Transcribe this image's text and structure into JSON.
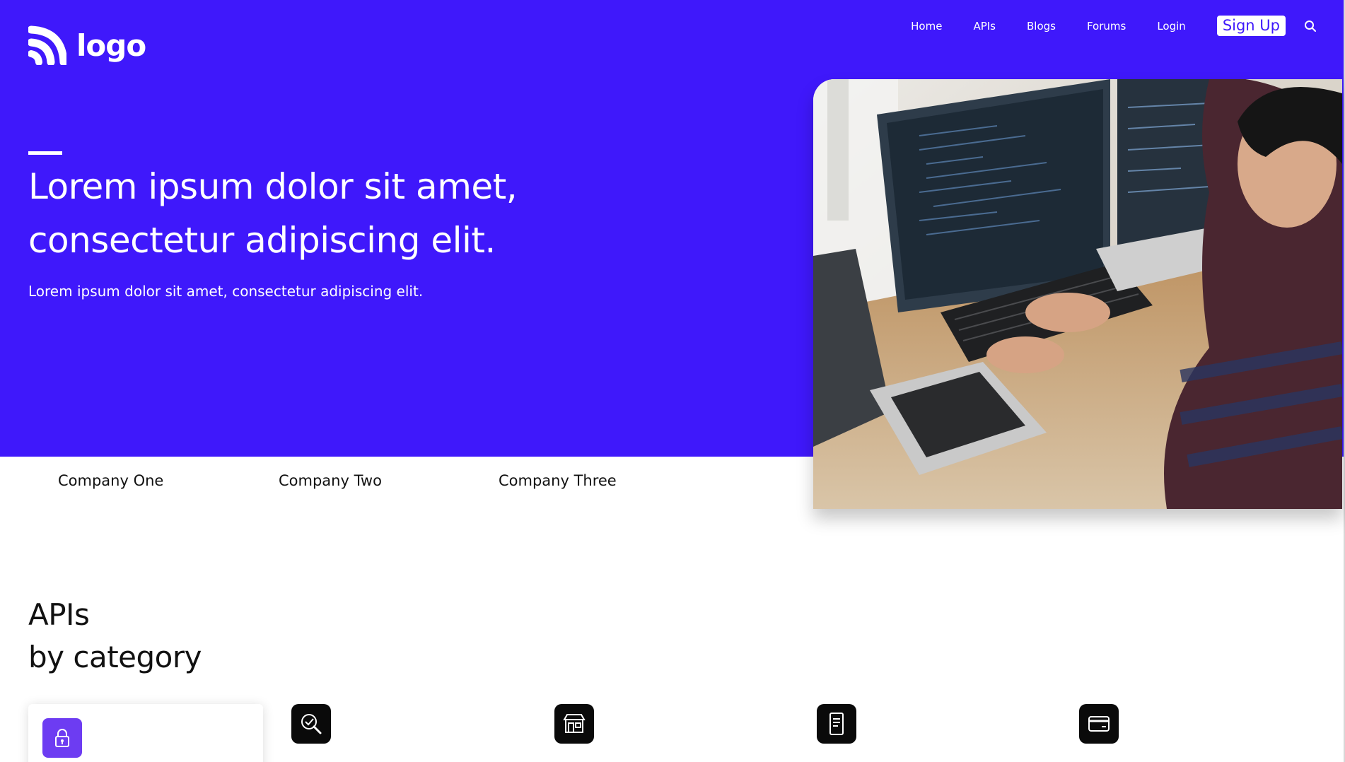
{
  "header": {
    "logo_text": "logo",
    "nav": [
      "Home",
      "APIs",
      "Blogs",
      "Forums",
      "Login"
    ],
    "signup_label": "Sign Up"
  },
  "hero": {
    "title": "Lorem ipsum dolor sit amet, consectetur adipiscing elit.",
    "subtitle": "Lorem ipsum dolor sit amet, consectetur adipiscing elit."
  },
  "companies": [
    "Company One",
    "Company Two",
    "Company Three"
  ],
  "section": {
    "title_line1": "APIs",
    "title_line2": "by category"
  },
  "icons": {
    "search": "search-icon",
    "card": "lock-icon",
    "categories": [
      "search-check-icon",
      "store-icon",
      "mobile-document-icon",
      "credit-card-icon"
    ]
  },
  "colors": {
    "brand": "#3f18fb",
    "card_icon": "#6d3cf2",
    "category_icon_bg": "#0a0a0a"
  }
}
